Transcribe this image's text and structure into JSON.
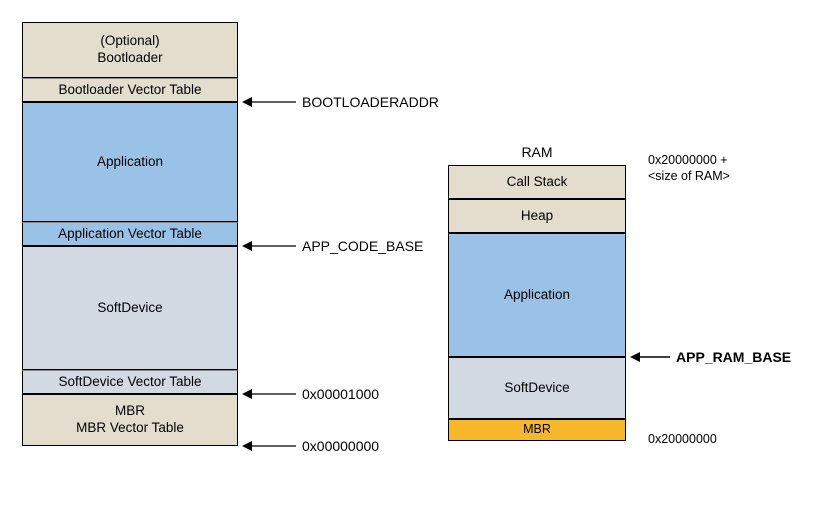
{
  "flash": {
    "bootloader": {
      "line1": "(Optional)",
      "line2": "Bootloader"
    },
    "bootloader_vt": "Bootloader Vector Table",
    "application": "Application",
    "app_vt": "Application Vector Table",
    "softdevice": "SoftDevice",
    "softdevice_vt": "SoftDevice Vector Table",
    "mbr": {
      "line1": "MBR",
      "line2": "MBR Vector Table"
    },
    "addr": {
      "bootloader": "BOOTLOADERADDR",
      "app": "APP_CODE_BASE",
      "sd": "0x00001000",
      "mbr": "0x00000000"
    }
  },
  "ram": {
    "title": "RAM",
    "call_stack": "Call Stack",
    "heap": "Heap",
    "application": "Application",
    "softdevice": "SoftDevice",
    "mbr": "MBR",
    "addr": {
      "top": {
        "line1": "0x20000000 +",
        "line2": "<size of RAM>"
      },
      "app_base": "APP_RAM_BASE",
      "bottom": "0x20000000"
    }
  }
}
